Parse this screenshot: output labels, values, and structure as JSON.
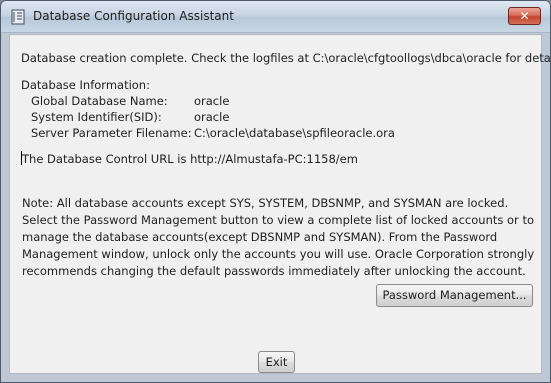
{
  "window": {
    "title": "Database Configuration Assistant",
    "close_label": "✕"
  },
  "content": {
    "status_message": "Database creation complete. Check the logfiles at C:\\oracle\\cfgtoollogs\\dbca\\oracle for details.",
    "info_heading": "Database Information:",
    "info": [
      {
        "label": "Global Database Name:",
        "value": "oracle"
      },
      {
        "label": "System Identifier(SID):",
        "value": "oracle"
      },
      {
        "label": "Server Parameter Filename:",
        "value": "C:\\oracle\\database\\spfileoracle.ora"
      }
    ],
    "control_url_text": "The Database Control URL is http://Almustafa-PC:1158/em",
    "note": "Note: All database accounts except SYS, SYSTEM, DBSNMP, and SYSMAN are locked. Select the Password Management button to view a complete list of locked accounts or to manage the database accounts(except DBSNMP and SYSMAN). From the Password Management window, unlock only the accounts you will use. Oracle Corporation strongly recommends changing the default passwords immediately after unlocking the account."
  },
  "buttons": {
    "password_management": "Password Management...",
    "exit": "Exit"
  }
}
